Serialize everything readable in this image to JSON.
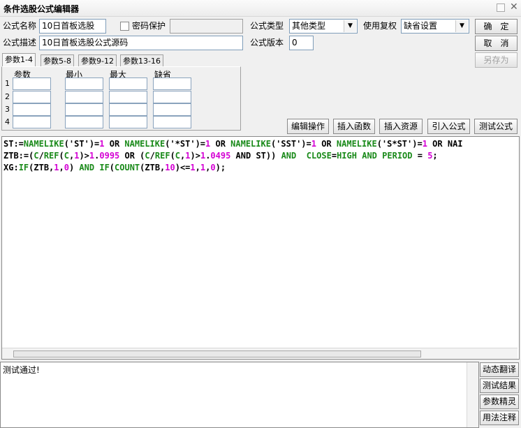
{
  "window": {
    "title": "条件选股公式编辑器"
  },
  "form": {
    "name_label": "公式名称",
    "name_value": "10日首板选股",
    "password_label": "密码保护",
    "desc_label": "公式描述",
    "desc_value": "10日首板选股公式源码",
    "type_label": "公式类型",
    "type_value": "其他类型",
    "reuse_label": "使用复权",
    "reuse_value": "缺省设置",
    "version_label": "公式版本",
    "version_value": "0"
  },
  "buttons": {
    "ok": "确　定",
    "cancel": "取　消",
    "save_as": "另存为",
    "edit_ops": "编辑操作",
    "insert_func": "插入函数",
    "insert_res": "插入资源",
    "import_formula": "引入公式",
    "test_formula": "测试公式"
  },
  "tabs": [
    "参数1-4",
    "参数5-8",
    "参数9-12",
    "参数13-16"
  ],
  "params": {
    "headers": [
      "参数",
      "最小",
      "最大",
      "缺省"
    ],
    "rows": [
      "1",
      "2",
      "3",
      "4"
    ]
  },
  "code_lines": [
    [
      [
        "ST:=",
        ""
      ],
      [
        "NAMELIKE",
        "kw"
      ],
      [
        "('ST')=",
        ""
      ],
      [
        "1",
        "num"
      ],
      [
        " OR ",
        ""
      ],
      [
        "NAMELIKE",
        "kw"
      ],
      [
        "('*ST')=",
        ""
      ],
      [
        "1",
        "num"
      ],
      [
        " OR ",
        ""
      ],
      [
        "NAMELIKE",
        "kw"
      ],
      [
        "('SST')=",
        ""
      ],
      [
        "1",
        "num"
      ],
      [
        " OR ",
        ""
      ],
      [
        "NAMELIKE",
        "kw"
      ],
      [
        "('S*ST')=",
        ""
      ],
      [
        "1",
        "num"
      ],
      [
        " OR NAI",
        ""
      ]
    ],
    [
      [
        "ZTB:=(",
        ""
      ],
      [
        "C",
        "kw"
      ],
      [
        "/",
        ""
      ],
      [
        "REF",
        "kw"
      ],
      [
        "(",
        ""
      ],
      [
        "C",
        "kw"
      ],
      [
        ",",
        ""
      ],
      [
        "1",
        "num"
      ],
      [
        ")>",
        ""
      ],
      [
        "1",
        "num"
      ],
      [
        ".",
        ""
      ],
      [
        "0995",
        "num"
      ],
      [
        " OR (",
        ""
      ],
      [
        "C",
        "kw"
      ],
      [
        "/",
        ""
      ],
      [
        "REF",
        "kw"
      ],
      [
        "(",
        ""
      ],
      [
        "C",
        "kw"
      ],
      [
        ",",
        ""
      ],
      [
        "1",
        "num"
      ],
      [
        ")>",
        ""
      ],
      [
        "1",
        "num"
      ],
      [
        ".",
        ""
      ],
      [
        "0495",
        "num"
      ],
      [
        " AND ST)) ",
        ""
      ],
      [
        "AND",
        "kw"
      ],
      [
        "  ",
        ""
      ],
      [
        "CLOSE",
        "kw"
      ],
      [
        "=",
        ""
      ],
      [
        "HIGH",
        "kw"
      ],
      [
        " ",
        ""
      ],
      [
        "AND",
        "kw"
      ],
      [
        " ",
        ""
      ],
      [
        "PERIOD",
        "kw"
      ],
      [
        " = ",
        ""
      ],
      [
        "5",
        "num"
      ],
      [
        ";",
        ""
      ]
    ],
    [
      [
        "XG:",
        ""
      ],
      [
        "IF",
        "kw"
      ],
      [
        "(ZTB,",
        ""
      ],
      [
        "1",
        "num"
      ],
      [
        ",",
        ""
      ],
      [
        "0",
        "num"
      ],
      [
        ") ",
        ""
      ],
      [
        "AND",
        "kw"
      ],
      [
        " ",
        ""
      ],
      [
        "IF",
        "kw"
      ],
      [
        "(",
        ""
      ],
      [
        "COUNT",
        "kw"
      ],
      [
        "(ZTB,",
        ""
      ],
      [
        "10",
        "num"
      ],
      [
        ")<=",
        ""
      ],
      [
        "1",
        "num"
      ],
      [
        ",",
        ""
      ],
      [
        "1",
        "num"
      ],
      [
        ",",
        ""
      ],
      [
        "0",
        "num"
      ],
      [
        ");",
        ""
      ]
    ]
  ],
  "output": {
    "text": "测试通过!"
  },
  "side_buttons": [
    "动态翻译",
    "测试结果",
    "参数精灵",
    "用法注释"
  ]
}
